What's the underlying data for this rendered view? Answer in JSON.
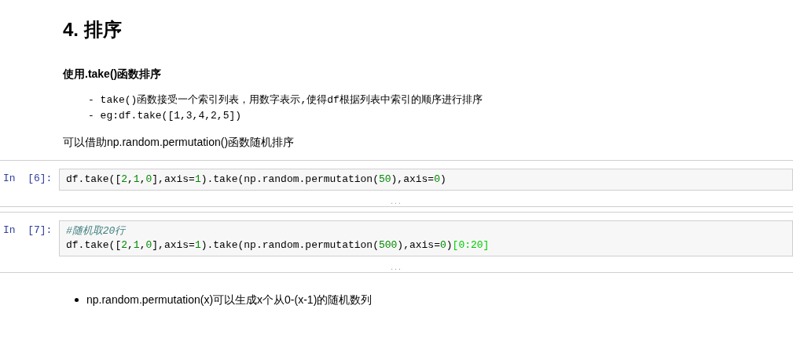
{
  "heading": "4. 排序",
  "subheading": "使用.take()函数排序",
  "preformatted": [
    "- take()函数接受一个索引列表，用数字表示,使得df根据列表中索引的顺序进行排序",
    "- eg:df.take([1,3,4,2,5])"
  ],
  "paragraph": "可以借助np.random.permutation()函数随机排序",
  "cells": [
    {
      "prompt": "In  [6]:",
      "output_collapsed": "...",
      "lines": [
        [
          {
            "text": "df.take([",
            "kind": "plain"
          },
          {
            "text": "2",
            "kind": "number"
          },
          {
            "text": ",",
            "kind": "plain"
          },
          {
            "text": "1",
            "kind": "number"
          },
          {
            "text": ",",
            "kind": "plain"
          },
          {
            "text": "0",
            "kind": "number"
          },
          {
            "text": "],axis=",
            "kind": "plain"
          },
          {
            "text": "1",
            "kind": "number"
          },
          {
            "text": ").take(np.random.permutation(",
            "kind": "plain"
          },
          {
            "text": "50",
            "kind": "number"
          },
          {
            "text": "),axis=",
            "kind": "plain"
          },
          {
            "text": "0",
            "kind": "number"
          },
          {
            "text": ")",
            "kind": "plain"
          }
        ]
      ]
    },
    {
      "prompt": "In  [7]:",
      "output_collapsed": "...",
      "lines": [
        [
          {
            "text": "#随机取20行",
            "kind": "comment"
          }
        ],
        [
          {
            "text": "df.take([",
            "kind": "plain"
          },
          {
            "text": "2",
            "kind": "number"
          },
          {
            "text": ",",
            "kind": "plain"
          },
          {
            "text": "1",
            "kind": "number"
          },
          {
            "text": ",",
            "kind": "plain"
          },
          {
            "text": "0",
            "kind": "number"
          },
          {
            "text": "],axis=",
            "kind": "plain"
          },
          {
            "text": "1",
            "kind": "number"
          },
          {
            "text": ").take(np.random.permutation(",
            "kind": "plain"
          },
          {
            "text": "500",
            "kind": "number"
          },
          {
            "text": "),axis=",
            "kind": "plain"
          },
          {
            "text": "0",
            "kind": "number"
          },
          {
            "text": ")",
            "kind": "plain"
          },
          {
            "text": "[0:20]",
            "kind": "match"
          }
        ]
      ]
    }
  ],
  "bullets": [
    "np.random.permutation(x)可以生成x个从0-(x-1)的随机数列"
  ]
}
